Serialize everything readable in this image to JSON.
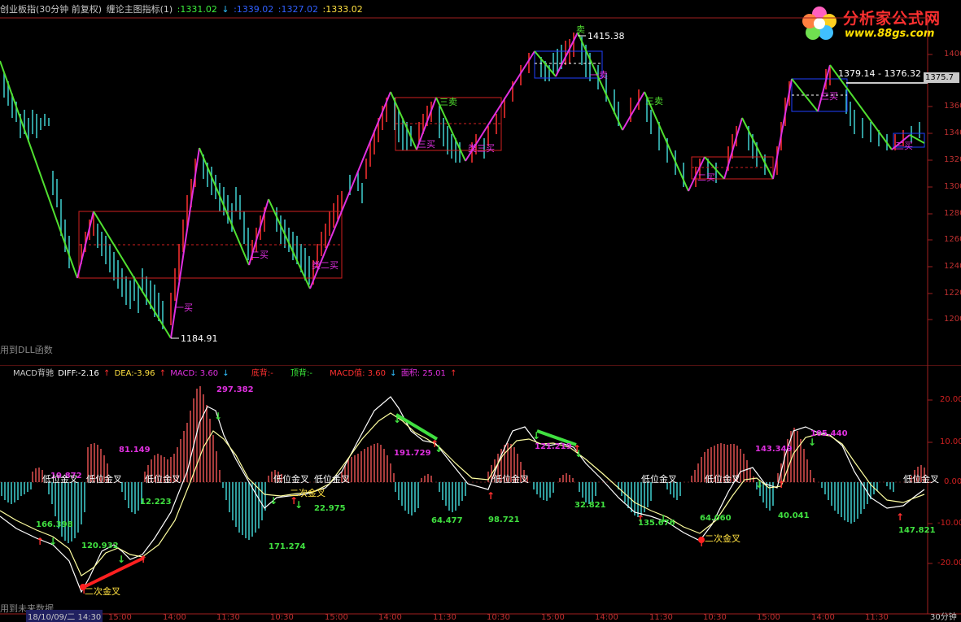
{
  "main_header": {
    "stock": "创业板指(30分钟 前复权)",
    "indicator": "缠论主图指标(1)",
    "v1": ":1331.02",
    "v2": ":1339.02",
    "v3": ":1327.02",
    "v4": ":1333.02"
  },
  "logo": {
    "brand": "分析家公式网",
    "url": "www.88gs.com"
  },
  "price_tag": "1375.7",
  "main_axis_labels": [
    "1400",
    "1380",
    "1360",
    "1340",
    "1320",
    "1300",
    "1280",
    "1260",
    "1240",
    "1220",
    "1200"
  ],
  "main_annotations": {
    "high_label": "1415.38",
    "low_label": "1184.91",
    "right_range": "1379.14 - 1376.32",
    "buy1": "一买",
    "buy2a": "二买",
    "buy2b": "类二买",
    "buy3a": "三买",
    "buy3b": "类三买",
    "sell1": "一卖",
    "sell3a": "三卖",
    "sell3b": "三卖",
    "buy2c": "二买",
    "buy3c": "三买",
    "buy2d": "一买",
    "buy3d": "三买",
    "sell_top": "卖"
  },
  "dll_note": "用到DLL函数",
  "future_note": "用到未来数据",
  "indicator_header": {
    "name": "MACD背驰",
    "diff": "DIFF:-2.16",
    "dea": "DEA:-3.96",
    "macd": "MACD: 3.60",
    "bottom_div": "底背:-",
    "top_div": "顶背:-",
    "macd_val": "MACD值: 3.60",
    "area": "面积: 25.01"
  },
  "ind_axis_labels": [
    "20.00",
    "10.00",
    "0.00",
    "-10.00",
    "-20.00"
  ],
  "ind_annotations": {
    "a1": "19.872",
    "a2": "166.398",
    "a3": "120.932",
    "a4": "81.149",
    "a5": "12.223",
    "a6": "297.382",
    "a7": "171.274",
    "a8": "22.975",
    "a9": "191.729",
    "a10": "64.477",
    "a11": "98.721",
    "a12": "121.219",
    "a13": "32.821",
    "a14": "135.676",
    "a15": "64.060",
    "a16": "143.349",
    "a17": "105.440",
    "a18": "40.041",
    "a19": "147.821",
    "g1": "低位金叉",
    "g2": "低位金叉",
    "g3": "低位金叉",
    "g4": "低位金叉",
    "g5": "低位金叉",
    "g6": "低位金叉",
    "g7": "低位金叉",
    "g8": "低位金叉",
    "g9": "低位金叉",
    "g10": "二次金叉",
    "g11": "二次金叉",
    "g12": "二次金叉"
  },
  "time_axis": [
    "18/10/09/二 14:30",
    "15:00",
    "14:00",
    "11:30",
    "10:30",
    "15:00",
    "14:00",
    "11:30",
    "10:30",
    "15:00",
    "14:00",
    "11:30",
    "10:30",
    "15:00",
    "14:00",
    "11:30",
    "30分钟"
  ]
}
